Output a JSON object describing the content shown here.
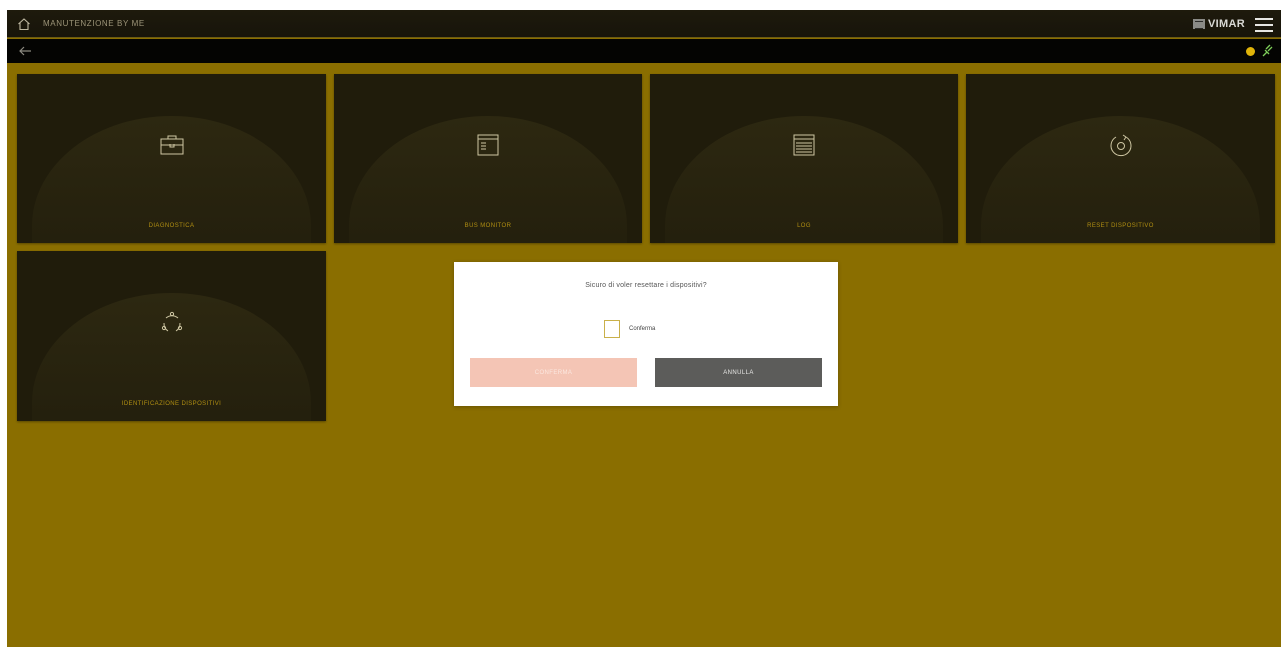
{
  "header": {
    "title": "MANUTENZIONE BY ME",
    "brand": "VIMAR",
    "icons": {
      "home": "home-icon",
      "menu": "hamburger-menu-icon",
      "back": "back-arrow-icon",
      "status": "status-dot-icon",
      "plug": "plug-icon"
    }
  },
  "tiles": [
    {
      "label": "DIAGNOSTICA",
      "icon": "toolbox-icon"
    },
    {
      "label": "BUS MONITOR",
      "icon": "monitor-window-icon"
    },
    {
      "label": "LOG",
      "icon": "log-list-icon"
    },
    {
      "label": "RESET DISPOSITIVO",
      "icon": "reset-icon"
    },
    {
      "label": "IDENTIFICAZIONE DISPOSITIVI",
      "icon": "devices-network-icon"
    }
  ],
  "dialog": {
    "question": "Sicuro di voler resettare i dispositivi?",
    "checkbox_label": "Conferma",
    "confirm_label": "CONFERMA",
    "cancel_label": "ANNULLA"
  },
  "colors": {
    "background": "#8a6e00",
    "tile": "#201c0b",
    "accent": "#e0b409",
    "confirm_button": "#f4c5b5",
    "cancel_button": "#5c5c5a"
  }
}
